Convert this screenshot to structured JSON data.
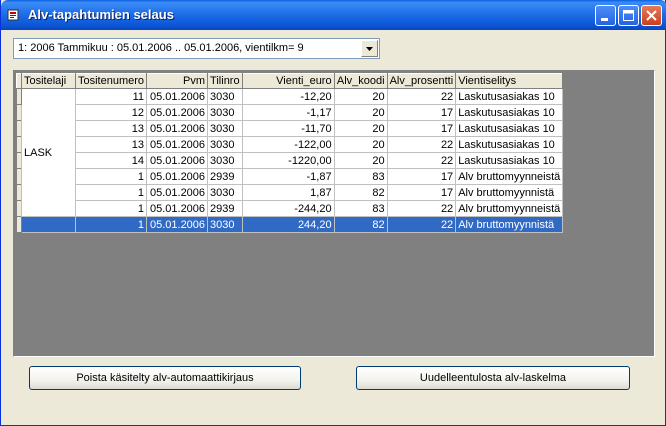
{
  "window": {
    "title": "Alv-tapahtumien selaus"
  },
  "period_select": {
    "value": "1: 2006 Tammikuu : 05.01.2006 .. 05.01.2006, vientilkm= 9"
  },
  "grid": {
    "columns": [
      "Tositelaji",
      "Tositenumero",
      "Pvm",
      "Tilinro",
      "Vienti_euro",
      "Alv_koodi",
      "Alv_prosentti",
      "Vientiselitys"
    ],
    "group_label": "LASK",
    "rows": [
      {
        "tositenumero": "11",
        "pvm": "05.01.2006",
        "tilinro": "3030",
        "vienti_euro": "-12,20",
        "alv_koodi": "20",
        "alv_prosentti": "22",
        "vientiselitys": "Laskutusasiakas 10"
      },
      {
        "tositenumero": "12",
        "pvm": "05.01.2006",
        "tilinro": "3030",
        "vienti_euro": "-1,17",
        "alv_koodi": "20",
        "alv_prosentti": "17",
        "vientiselitys": "Laskutusasiakas 10"
      },
      {
        "tositenumero": "13",
        "pvm": "05.01.2006",
        "tilinro": "3030",
        "vienti_euro": "-11,70",
        "alv_koodi": "20",
        "alv_prosentti": "17",
        "vientiselitys": "Laskutusasiakas 10"
      },
      {
        "tositenumero": "13",
        "pvm": "05.01.2006",
        "tilinro": "3030",
        "vienti_euro": "-122,00",
        "alv_koodi": "20",
        "alv_prosentti": "22",
        "vientiselitys": "Laskutusasiakas 10"
      },
      {
        "tositenumero": "14",
        "pvm": "05.01.2006",
        "tilinro": "3030",
        "vienti_euro": "-1220,00",
        "alv_koodi": "20",
        "alv_prosentti": "22",
        "vientiselitys": "Laskutusasiakas 10"
      },
      {
        "tositenumero": "1",
        "pvm": "05.01.2006",
        "tilinro": "2939",
        "vienti_euro": "-1,87",
        "alv_koodi": "83",
        "alv_prosentti": "17",
        "vientiselitys": "Alv bruttomyynneistä"
      },
      {
        "tositenumero": "1",
        "pvm": "05.01.2006",
        "tilinro": "3030",
        "vienti_euro": "1,87",
        "alv_koodi": "82",
        "alv_prosentti": "17",
        "vientiselitys": "Alv bruttomyynnistä"
      },
      {
        "tositenumero": "1",
        "pvm": "05.01.2006",
        "tilinro": "2939",
        "vienti_euro": "-244,20",
        "alv_koodi": "83",
        "alv_prosentti": "22",
        "vientiselitys": "Alv bruttomyynneistä"
      },
      {
        "tositenumero": "1",
        "pvm": "05.01.2006",
        "tilinro": "3030",
        "vienti_euro": "244,20",
        "alv_koodi": "82",
        "alv_prosentti": "22",
        "vientiselitys": "Alv bruttomyynnistä"
      }
    ]
  },
  "buttons": {
    "remove_label": "Poista käsitelty alv-automaattikirjaus",
    "reprint_label": "Uudelleentulosta alv-laskelma"
  }
}
